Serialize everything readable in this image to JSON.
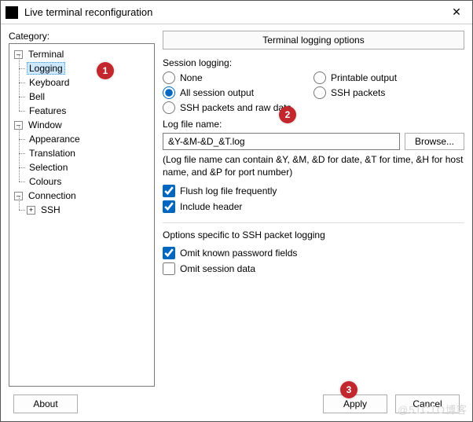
{
  "window": {
    "title": "Live terminal reconfiguration",
    "close": "✕"
  },
  "category_label": "Category:",
  "tree": {
    "terminal": "Terminal",
    "logging": "Logging",
    "keyboard": "Keyboard",
    "bell": "Bell",
    "features": "Features",
    "window": "Window",
    "appearance": "Appearance",
    "translation": "Translation",
    "selection": "Selection",
    "colours": "Colours",
    "connection": "Connection",
    "ssh": "SSH",
    "toggle_minus": "–",
    "toggle_plus": "+"
  },
  "panel_title": "Terminal logging options",
  "session_logging_label": "Session logging:",
  "radios": {
    "none": "None",
    "printable": "Printable output",
    "all": "All session output",
    "sshpkt": "SSH packets",
    "sshraw": "SSH packets and raw data"
  },
  "logfile_label": "Log file name:",
  "logfile_value": "&Y-&M-&D_&T.log",
  "browse_label": "Browse...",
  "logfile_hint": "(Log file name can contain &Y, &M, &D for date, &T for time, &H for host name, and &P for port number)",
  "checks": {
    "flush": "Flush log file frequently",
    "header": "Include header"
  },
  "ssh_section_label": "Options specific to SSH packet logging",
  "ssh_checks": {
    "omit_pw": "Omit known password fields",
    "omit_sess": "Omit session data"
  },
  "buttons": {
    "about": "About",
    "apply": "Apply",
    "cancel": "Cancel"
  },
  "annotations": {
    "a1": "1",
    "a2": "2",
    "a3": "3"
  },
  "watermark": "@51CTO博客"
}
